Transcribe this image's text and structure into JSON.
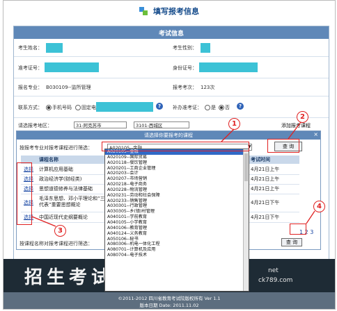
{
  "page_title": "填写报考信息",
  "panel_title": "考试信息",
  "fields": {
    "name_label": "考生姓名：",
    "gender_label": "考生性别：",
    "ticket_label": "准考证号：",
    "id_label": "身份证号：",
    "major_label": "报名专业：",
    "major_value": "B030109--监所管理",
    "times_label": "报考考次：",
    "times_value": "123次",
    "contact_label": "联系方式：",
    "contact_opt1": "手机号码",
    "contact_opt2": "固定电话",
    "reissue_label": "补办准考证：",
    "reissue_yes": "是",
    "reissue_no": "否",
    "region_label": "请选报考地区：",
    "region_city": "31-阿克苏市",
    "region_district": "3101-西城区",
    "add_course_button": "添加报考课程"
  },
  "dialog": {
    "title": "请选择你要报考的课程",
    "close": "×",
    "filter_label": "按报考专业对报考课程进行筛选：",
    "filter_value": "A020105--金融",
    "query_button": "查 询",
    "col_course": "课程名称",
    "col_time": "考试时间",
    "rows": [
      {
        "pick": "选择",
        "name": "计算机应用基础",
        "time": "4月21日上午"
      },
      {
        "pick": "选择",
        "name": "政治经济学(财经类)",
        "time": "4月21日上午"
      },
      {
        "pick": "选择",
        "name": "思想道德修养与法律基础",
        "time": "4月21日上午"
      },
      {
        "pick": "选择",
        "name": "毛泽东思想、邓小平理论和“三个代表”重要思想概论",
        "time": "4月21日下午"
      },
      {
        "pick": "选择",
        "name": "中国近现代史纲要概论",
        "time": "4月21日下午"
      }
    ],
    "pagination": "1 2 3",
    "name_filter_label": "按课程名称对报考课程进行筛选：",
    "query_button2": "查 询"
  },
  "dropdown_items": [
    "A020105--金融",
    "A020109--国际贸易",
    "A020118--餐饮管理",
    "A020201--工商企业管理",
    "A020203--会计",
    "A020207--市场营销",
    "A020218--电子商务",
    "A020228--物流管理",
    "A020231--劳动和社会保障",
    "A020233--销售管理",
    "A030301--行政管理",
    "A030305--乡(镇)村管理",
    "A040101--学前教育",
    "A040105--小学教育",
    "A040106--教育管理",
    "A040124--义务教育",
    "A050106--秘书",
    "A080306--机电一体化工程",
    "A080701--计算机及应用",
    "A080704--电子技术"
  ],
  "annotations": [
    "1",
    "2",
    "3",
    "4"
  ],
  "banner": {
    "text": "招生考试信",
    "url1": "net",
    "url2": "ck789.com"
  },
  "footer": {
    "line1": "©2011-2012 四川省教育考试院版权所有 Ver 1.1",
    "line2": "版本日期 Date: 2011.11.02"
  },
  "colors": {
    "header_blue": "#5f88b8",
    "highlight": "#3169c6",
    "annotation_red": "#e02020",
    "redaction": "#3cc2d6"
  }
}
